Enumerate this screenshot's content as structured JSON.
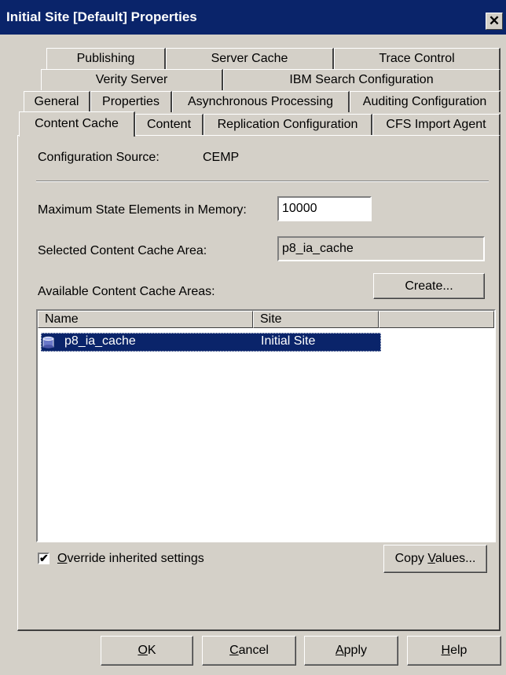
{
  "window": {
    "title": "Initial Site [Default] Properties",
    "close_glyph": "✕"
  },
  "tabs": {
    "row1": [
      "Publishing",
      "Server Cache",
      "Trace Control"
    ],
    "row2": [
      "Verity Server",
      "IBM Search Configuration"
    ],
    "row3": [
      "General",
      "Properties",
      "Asynchronous Processing",
      "Auditing Configuration"
    ],
    "row4": [
      "Content Cache",
      "Content",
      "Replication Configuration",
      "CFS Import Agent"
    ],
    "active": "Content Cache"
  },
  "content_cache": {
    "config_source_label": "Configuration Source:",
    "config_source_value": "CEMP",
    "max_state_label": "Maximum State Elements in Memory:",
    "max_state_value": "10000",
    "selected_area_label": "Selected Content Cache Area:",
    "selected_area_value": "p8_ia_cache",
    "available_label": "Available Content Cache Areas:",
    "create_button": "Create...",
    "columns": [
      "Name",
      "Site"
    ],
    "rows": [
      {
        "name": "p8_ia_cache",
        "site": "Initial Site",
        "icon": "database-icon",
        "selected": true
      }
    ],
    "override_checked": true,
    "override_mnemonic": "O",
    "override_rest": "verride inherited settings",
    "copy_values_pre": "Copy ",
    "copy_values_mnemonic": "V",
    "copy_values_post": "alues..."
  },
  "footer": {
    "ok_mnemonic": "O",
    "ok_rest": "K",
    "cancel_mnemonic": "C",
    "cancel_rest": "ancel",
    "apply_mnemonic": "A",
    "apply_rest": "pply",
    "help_mnemonic": "H",
    "help_rest": "elp"
  },
  "colors": {
    "face": "#d4d0c8",
    "title_bar": "#0a246a",
    "selection": "#0a246a"
  }
}
